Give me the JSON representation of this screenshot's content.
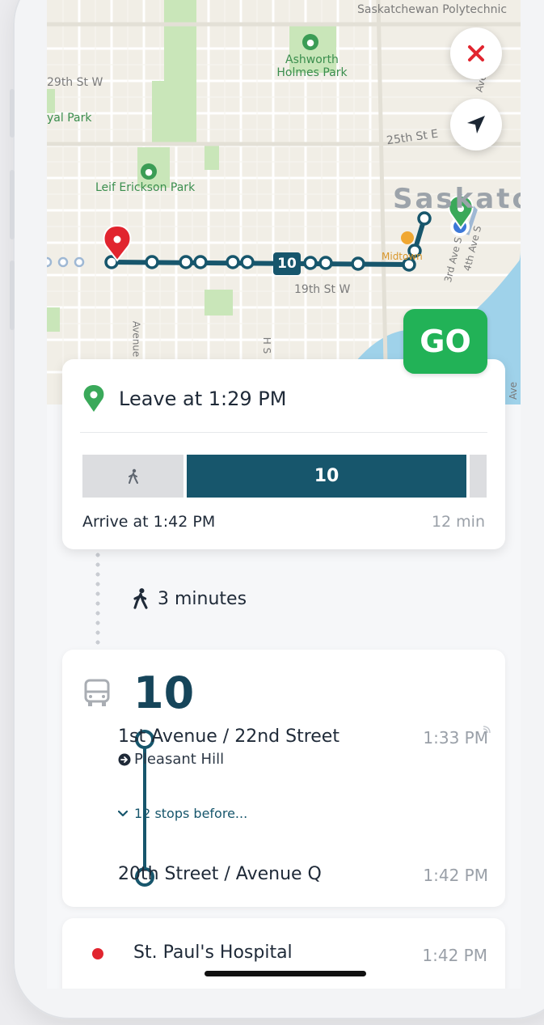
{
  "map": {
    "labels": {
      "polytechnic": "Saskatchewan Polytechnic",
      "ashworth": "Ashworth Holmes Park",
      "street_29th": "29th St W",
      "royal_park": "yal Park",
      "street_25th": "25th St E",
      "leif": "Leif Erickson Park",
      "city": "Saskatoo",
      "midtown": "Midtown",
      "street_19th": "19th St W",
      "ave_3rd": "3rd Ave S",
      "ave_4th": "4th Ave S",
      "avenue_vert": "Avenue",
      "ave_h": "H S",
      "ave_right": "Ave",
      "ave_top": "Ave"
    },
    "route_badge": "10",
    "colors": {
      "route": "#17566c",
      "water": "#9fd2ea",
      "park": "#c9e6b9",
      "origin_pin": "#3aa95a",
      "dest_pin": "#e1252f"
    }
  },
  "controls": {
    "close_icon": "close-icon",
    "locate_icon": "navigation-arrow-icon",
    "go_label": "GO"
  },
  "trip": {
    "leave_label": "Leave at 1:29 PM",
    "bus_segment_label": "10",
    "arrive_label": "Arrive at 1:42 PM",
    "duration": "12 min"
  },
  "walk": {
    "label": "3 minutes"
  },
  "bus": {
    "route_number": "10",
    "board_stop": "1st Avenue / 22nd Street",
    "board_time": "1:33 PM",
    "direction": "Pleasant Hill",
    "stops_before": "12 stops before...",
    "alight_stop": "20th Street / Avenue Q",
    "alight_time": "1:42 PM"
  },
  "destination": {
    "name": "St. Paul's Hospital",
    "time": "1:42 PM"
  }
}
